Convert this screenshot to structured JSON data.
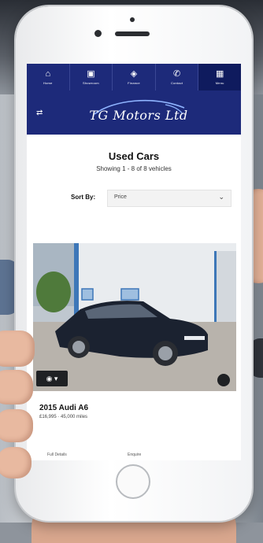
{
  "nav": {
    "items": [
      {
        "label": "Home",
        "icon": "home-icon",
        "glyph": "⌂"
      },
      {
        "label": "Showroom",
        "icon": "lock-icon",
        "glyph": "▣"
      },
      {
        "label": "Finance",
        "icon": "shield-icon",
        "glyph": "◈"
      },
      {
        "label": "Contact",
        "icon": "phone-icon",
        "glyph": "✆"
      },
      {
        "label": "Menu",
        "icon": "grid-icon",
        "glyph": "▦"
      }
    ]
  },
  "header": {
    "logo_text": "TG Motors Ltd",
    "menu_glyph": "⇄"
  },
  "page": {
    "title": "Used Cars",
    "subtitle": "Showing 1 - 8 of 8 vehicles"
  },
  "sort": {
    "label": "Sort By:",
    "selected": "Price",
    "chevron": "⌄"
  },
  "listing": {
    "name": "2015 Audi A6",
    "price": "£16,995 · 45,000 miles",
    "image_button_glyph": "◉ ▾",
    "footer_left": "Full Details",
    "footer_right": "Enquire"
  },
  "colors": {
    "brand": "#1d2a7a",
    "brand_dark": "#0f1b5e"
  }
}
